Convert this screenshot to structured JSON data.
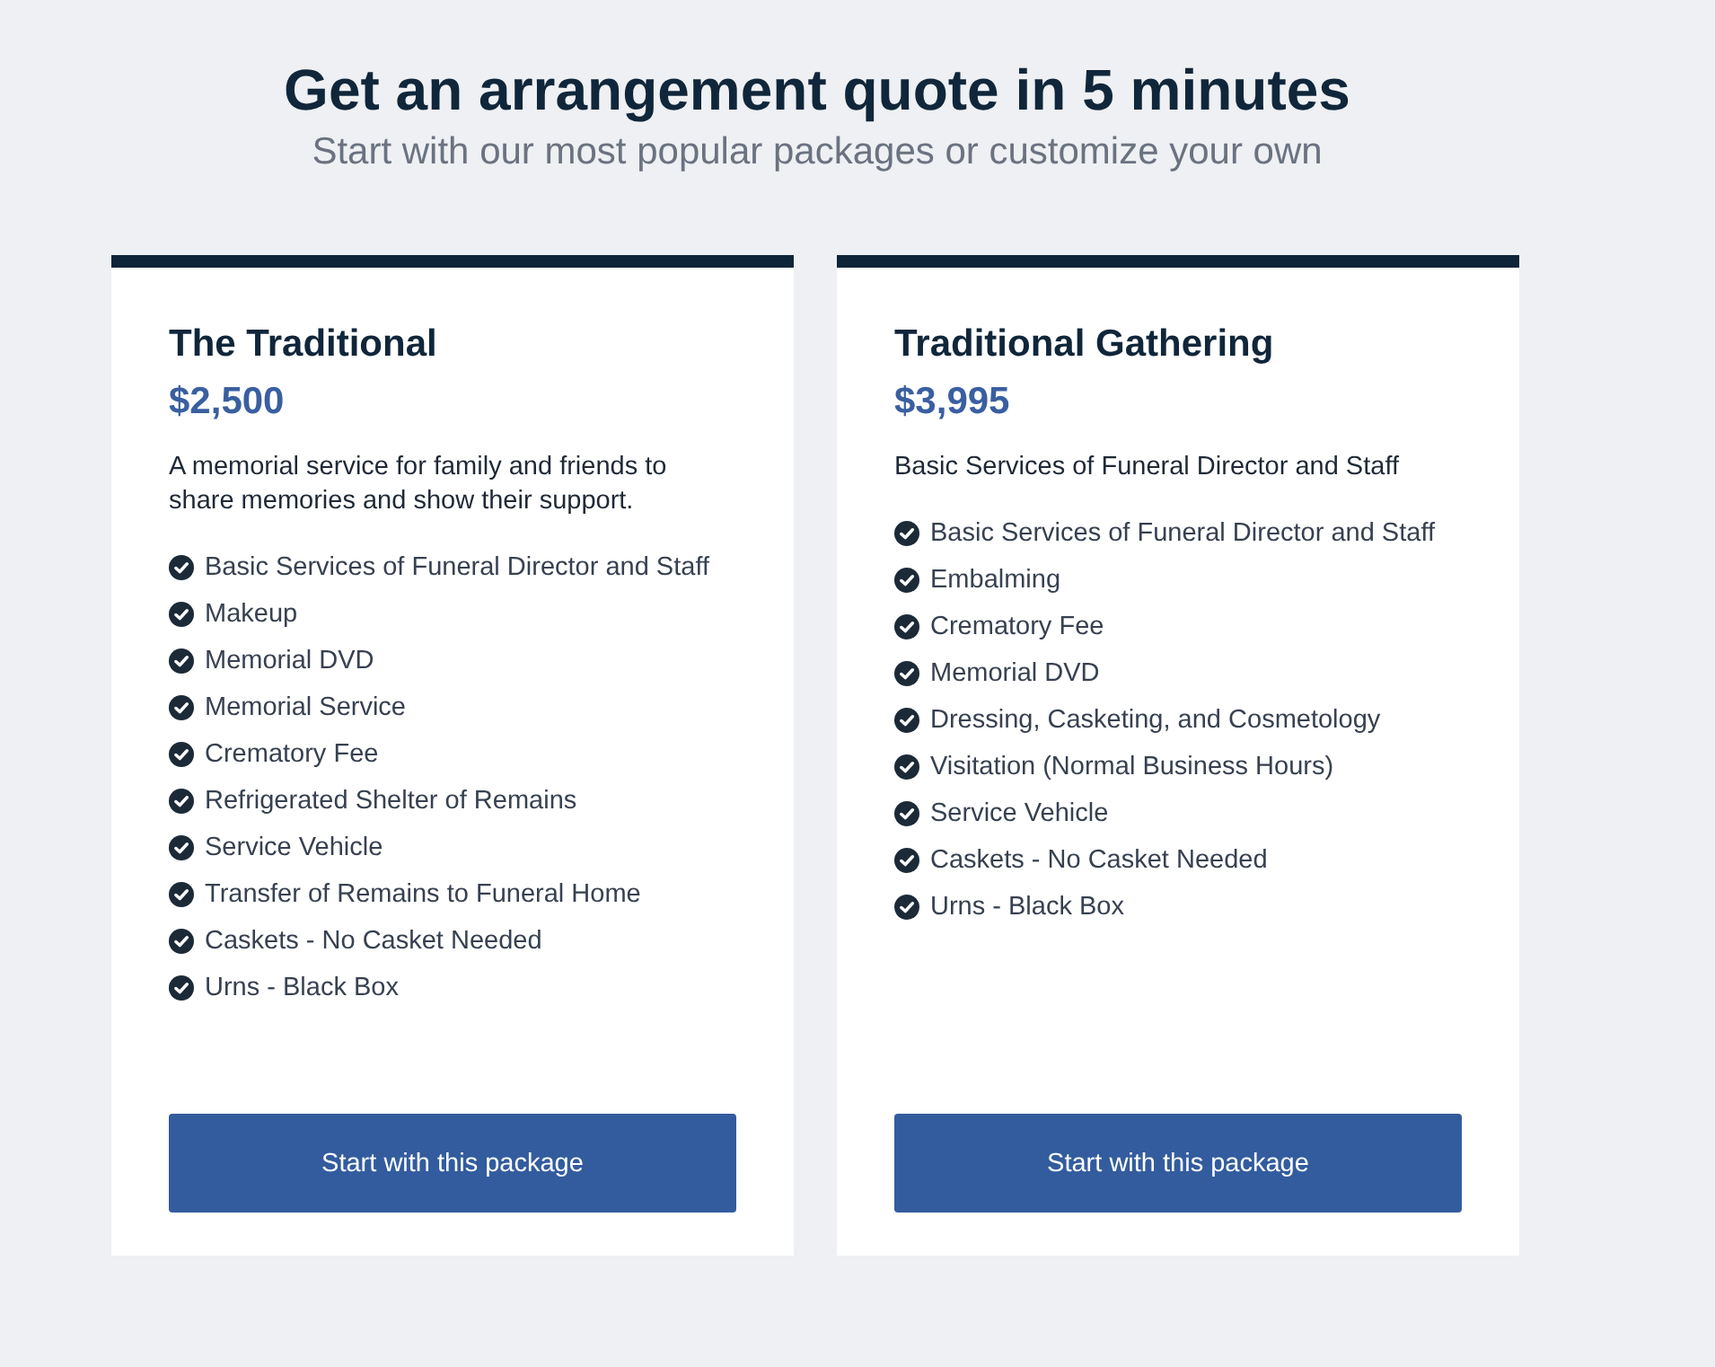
{
  "header": {
    "title": "Get an arrangement quote in 5 minutes",
    "subtitle": "Start with our most popular packages or customize your own"
  },
  "packages": [
    {
      "name": "The Traditional",
      "price": "$2,500",
      "description": "A memorial service for family and friends to share memories and show their support.",
      "items": [
        "Basic Services of Funeral Director and Staff",
        "Makeup",
        "Memorial DVD",
        "Memorial Service",
        "Crematory Fee",
        "Refrigerated Shelter of Remains",
        "Service Vehicle",
        "Transfer of Remains to Funeral Home",
        "Caskets - No Casket Needed",
        "Urns - Black Box"
      ],
      "button": "Start with this package"
    },
    {
      "name": "Traditional Gathering",
      "price": "$3,995",
      "description": "Basic Services of Funeral Director and Staff",
      "items": [
        "Basic Services of Funeral Director and Staff",
        "Embalming",
        "Crematory Fee",
        "Memorial DVD",
        "Dressing, Casketing, and Cosmetology",
        "Visitation (Normal Business Hours)",
        "Service Vehicle",
        "Caskets - No Casket Needed",
        "Urns - Black Box"
      ],
      "button": "Start with this package"
    }
  ]
}
